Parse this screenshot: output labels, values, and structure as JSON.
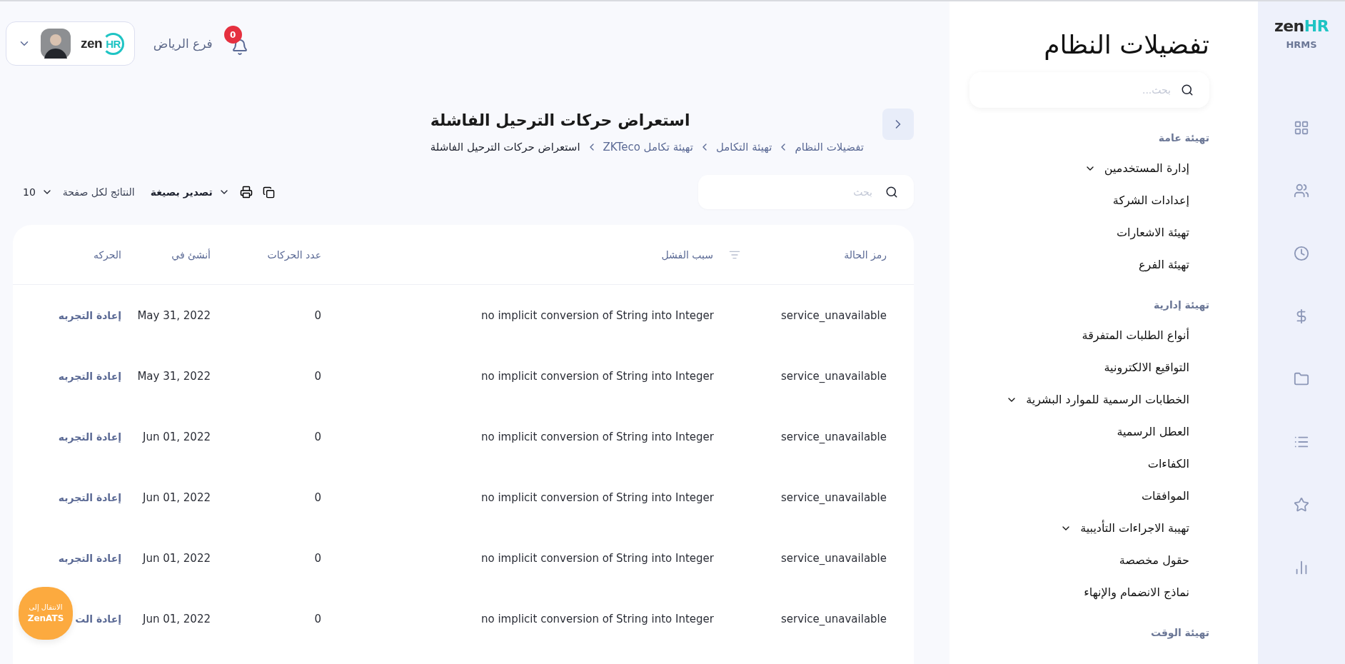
{
  "topbar": {
    "logo_text": "zen",
    "logo_accent": "HR",
    "branch": "فرع الرياض",
    "notification_count": "0"
  },
  "page": {
    "title": "استعراض حركات الترحيل الفاشلة",
    "breadcrumb": [
      {
        "label": "تفضيلات النظام",
        "current": false
      },
      {
        "label": "تهيئة التكامل",
        "current": false
      },
      {
        "label": "تهيئة تكامل ZKTeco",
        "current": false
      },
      {
        "label": "استعراض حركات الترحيل الفاشلة",
        "current": true
      }
    ]
  },
  "search": {
    "placeholder": "بحث"
  },
  "toolbar": {
    "export_label": "تصدير بصيغة",
    "per_page_label": "النتائج لكل صفحة",
    "per_page_value": "10"
  },
  "table": {
    "columns": [
      "رمز الحالة",
      "سبب الفشل",
      "عدد الحركات",
      "أنشئ في",
      "الحركه"
    ],
    "rows": [
      {
        "status_code": "service_unavailable",
        "reason": "no implicit conversion of String into Integer",
        "count": "0",
        "created_at": "May 31, 2022",
        "action": "إعادة التجربه"
      },
      {
        "status_code": "service_unavailable",
        "reason": "no implicit conversion of String into Integer",
        "count": "0",
        "created_at": "May 31, 2022",
        "action": "إعادة التجربه"
      },
      {
        "status_code": "service_unavailable",
        "reason": "no implicit conversion of String into Integer",
        "count": "0",
        "created_at": "Jun 01, 2022",
        "action": "إعادة التجربه"
      },
      {
        "status_code": "service_unavailable",
        "reason": "no implicit conversion of String into Integer",
        "count": "0",
        "created_at": "Jun 01, 2022",
        "action": "إعادة التجربه"
      },
      {
        "status_code": "service_unavailable",
        "reason": "no implicit conversion of String into Integer",
        "count": "0",
        "created_at": "Jun 01, 2022",
        "action": "إعادة التجربه"
      },
      {
        "status_code": "service_unavailable",
        "reason": "no implicit conversion of String into Integer",
        "count": "0",
        "created_at": "Jun 01, 2022",
        "action": "إعادة الت"
      }
    ]
  },
  "floating_button": {
    "line_1": "الانتقال إلى",
    "line_2": "ZenATS"
  },
  "settings_sidebar": {
    "title": "تفضيلات النظام",
    "search_placeholder": "بحث...",
    "groups": [
      {
        "label": "تهيئة عامة",
        "items": [
          {
            "label": "إدارة المستخدمين",
            "expandable": true
          },
          {
            "label": "إعدادات الشركة",
            "expandable": false
          },
          {
            "label": "تهيئة الاشعارات",
            "expandable": false
          },
          {
            "label": "تهيئة الفرع",
            "expandable": false
          }
        ]
      },
      {
        "label": "تهيئة إدارية",
        "items": [
          {
            "label": "أنواع الطلبات المتفرقة",
            "expandable": false
          },
          {
            "label": "التواقيع الالكترونية",
            "expandable": false
          },
          {
            "label": "الخطابات الرسمية للموارد البشرية",
            "expandable": true
          },
          {
            "label": "العطل الرسمية",
            "expandable": false
          },
          {
            "label": "الكفاءات",
            "expandable": false
          },
          {
            "label": "الموافقات",
            "expandable": false
          },
          {
            "label": "تهيبة الاجراءات التأديبية",
            "expandable": true
          },
          {
            "label": "حقول مخصصة",
            "expandable": false
          },
          {
            "label": "نماذج الانضمام والإنهاء",
            "expandable": false
          }
        ]
      },
      {
        "label": "تهيئة الوقت"
      }
    ]
  },
  "rail": {
    "logo_text": "zen",
    "logo_accent": "HR",
    "product": "HRMS",
    "items": [
      {
        "kind": "grid"
      },
      {
        "kind": "users"
      },
      {
        "kind": "clock"
      },
      {
        "kind": "dollar"
      },
      {
        "kind": "folder"
      },
      {
        "kind": "list"
      },
      {
        "kind": "star"
      },
      {
        "kind": "chart"
      }
    ]
  }
}
